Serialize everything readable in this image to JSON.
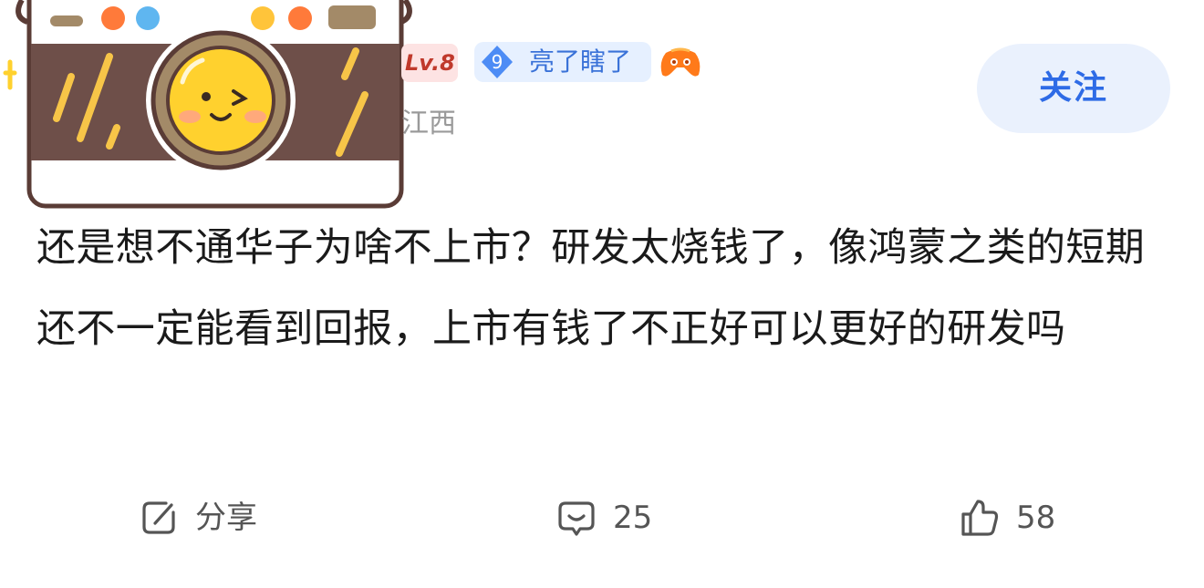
{
  "user": {
    "level": "Lv.8",
    "honor_number": "9",
    "honor_label": "亮了瞎了",
    "location": "江西"
  },
  "header": {
    "follow_label": "关注"
  },
  "post": {
    "text": "还是想不通华子为啥不上市？研发太烧钱了，像鸿蒙之类的短期还不一定能看到回报，上市有钱了不正好可以更好的研发吗"
  },
  "actions": {
    "share_label": "分享",
    "comment_count": "25",
    "like_count": "58"
  },
  "colors": {
    "accent": "#2e6be6",
    "follow_bg": "#eaf1fd",
    "level_red": "#c0392b",
    "honor_blue": "#3a72d8"
  },
  "icons": {
    "avatar": "camera-avatar-icon",
    "honor": "diamond-badge-icon",
    "game": "game-controller-icon",
    "share": "share-icon",
    "comment": "comment-icon",
    "like": "thumbs-up-icon"
  }
}
